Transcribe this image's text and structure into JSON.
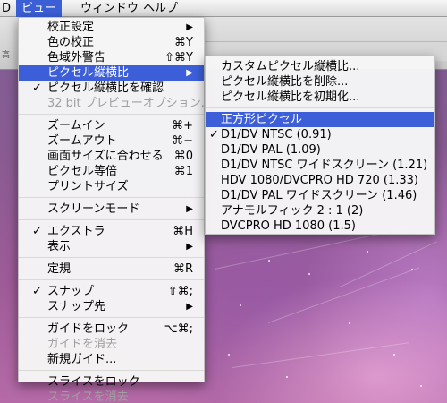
{
  "menubar": {
    "items": [
      {
        "label": "D"
      },
      {
        "label": "ビュー"
      },
      {
        "label": "ウィンドウ"
      },
      {
        "label": "ヘルプ"
      }
    ],
    "active_index": 1
  },
  "app_window": {
    "partial_label": "高"
  },
  "view_menu": {
    "groups": [
      [
        {
          "label": "校正設定",
          "submenu": true
        },
        {
          "label": "色の校正",
          "shortcut": "⌘Y"
        },
        {
          "label": "色域外警告",
          "shortcut": "⇧⌘Y"
        },
        {
          "label": "ピクセル縦横比",
          "submenu": true,
          "highlighted": true
        },
        {
          "label": "ピクセル縦横比を確認",
          "checked": true
        },
        {
          "label": "32 bit プレビューオプション...",
          "disabled": true
        }
      ],
      [
        {
          "label": "ズームイン",
          "shortcut": "⌘+"
        },
        {
          "label": "ズームアウト",
          "shortcut": "⌘−"
        },
        {
          "label": "画面サイズに合わせる",
          "shortcut": "⌘0"
        },
        {
          "label": "ピクセル等倍",
          "shortcut": "⌘1"
        },
        {
          "label": "プリントサイズ"
        }
      ],
      [
        {
          "label": "スクリーンモード",
          "submenu": true
        }
      ],
      [
        {
          "label": "エクストラ",
          "checked": true,
          "shortcut": "⌘H"
        },
        {
          "label": "表示",
          "submenu": true
        }
      ],
      [
        {
          "label": "定規",
          "shortcut": "⌘R"
        }
      ],
      [
        {
          "label": "スナップ",
          "checked": true,
          "shortcut": "⇧⌘;"
        },
        {
          "label": "スナップ先",
          "submenu": true
        }
      ],
      [
        {
          "label": "ガイドをロック",
          "shortcut": "⌥⌘;"
        },
        {
          "label": "ガイドを消去",
          "disabled": true
        },
        {
          "label": "新規ガイド..."
        }
      ],
      [
        {
          "label": "スライスをロック"
        },
        {
          "label": "スライスを消去",
          "disabled": true
        }
      ]
    ]
  },
  "aspect_submenu": {
    "groups": [
      [
        {
          "label": "カスタムピクセル縦横比..."
        },
        {
          "label": "ピクセル縦横比を削除..."
        },
        {
          "label": "ピクセル縦横比を初期化..."
        }
      ],
      [
        {
          "label": "正方形ピクセル",
          "highlighted": true
        },
        {
          "label": "D1/DV NTSC (0.91)",
          "checked": true
        },
        {
          "label": "D1/DV PAL (1.09)"
        },
        {
          "label": "D1/DV NTSC ワイドスクリーン (1.21)"
        },
        {
          "label": "HDV 1080/DVCPRO HD 720 (1.33)"
        },
        {
          "label": "D1/DV PAL ワイドスクリーン (1.46)"
        },
        {
          "label": "アナモルフィック 2 : 1 (2)"
        },
        {
          "label": "DVCPRO HD 1080 (1.5)"
        }
      ]
    ]
  },
  "glyphs": {
    "check": "✓",
    "submenu_arrow": "▶"
  },
  "colors": {
    "highlight": "#3c5fd9",
    "disabled_text": "#a0a0a0"
  }
}
